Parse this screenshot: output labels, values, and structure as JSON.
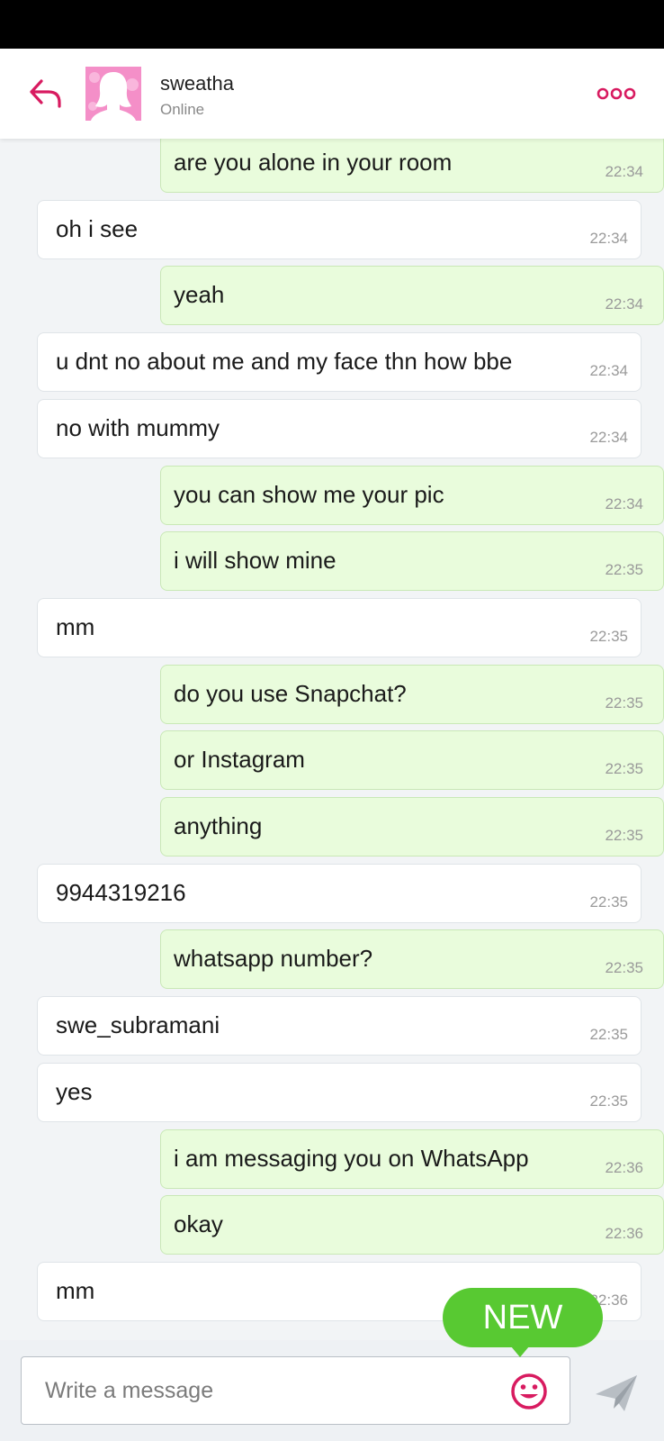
{
  "header": {
    "contact_name": "sweatha",
    "contact_status": "Online"
  },
  "icons": {
    "back": "reply-arrow-icon",
    "more": "three-dots-icon",
    "emoji": "smiley-icon",
    "send": "paper-plane-icon",
    "avatar": "female-silhouette-avatar"
  },
  "colors": {
    "accent": "#d81b60",
    "incoming_bubble": "#ffffff",
    "outgoing_bubble": "#e9fcdc",
    "new_badge": "#58c932",
    "send_icon": "#b8bec4"
  },
  "messages": [
    {
      "dir": "out",
      "text": "are you alone in your room",
      "time": "22:34"
    },
    {
      "dir": "in",
      "text": "oh i see",
      "time": "22:34"
    },
    {
      "dir": "out",
      "text": "yeah",
      "time": "22:34"
    },
    {
      "dir": "in",
      "text": "u dnt no about me and my face thn how bbe",
      "time": "22:34"
    },
    {
      "dir": "in",
      "text": "no with mummy",
      "time": "22:34"
    },
    {
      "dir": "out",
      "text": "you can show me your pic",
      "time": "22:34"
    },
    {
      "dir": "out",
      "text": "i will show mine",
      "time": "22:35"
    },
    {
      "dir": "in",
      "text": "mm",
      "time": "22:35"
    },
    {
      "dir": "out",
      "text": "do you use Snapchat?",
      "time": "22:35"
    },
    {
      "dir": "out",
      "text": "or Instagram",
      "time": "22:35"
    },
    {
      "dir": "out",
      "text": "anything",
      "time": "22:35"
    },
    {
      "dir": "in",
      "text": "9944319216",
      "time": "22:35"
    },
    {
      "dir": "out",
      "text": "whatsapp number?",
      "time": "22:35"
    },
    {
      "dir": "in",
      "text": "swe_subramani",
      "time": "22:35"
    },
    {
      "dir": "in",
      "text": "yes",
      "time": "22:35"
    },
    {
      "dir": "out",
      "text": "i am messaging you on WhatsApp",
      "time": "22:36"
    },
    {
      "dir": "out",
      "text": "okay",
      "time": "22:36"
    },
    {
      "dir": "in",
      "text": "mm",
      "time": "22:36"
    }
  ],
  "new_badge": "NEW",
  "composer": {
    "placeholder": "Write a message"
  }
}
